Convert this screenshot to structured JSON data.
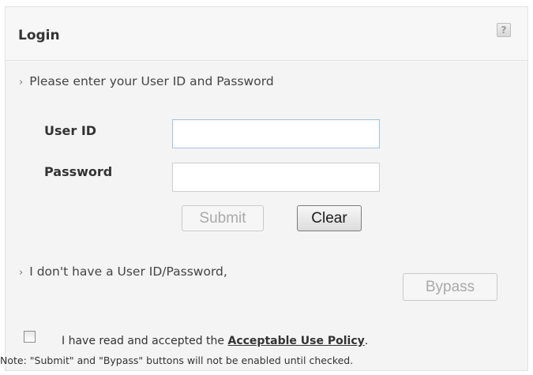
{
  "header": {
    "title": "Login",
    "help_icon": "?"
  },
  "instructions": {
    "enter_credentials": "Please enter your User ID and Password",
    "no_credentials": "I don't have a User ID/Password,"
  },
  "form": {
    "user_id_label": "User ID",
    "password_label": "Password",
    "user_id_value": "",
    "password_value": "",
    "submit_label": "Submit",
    "clear_label": "Clear",
    "bypass_label": "Bypass"
  },
  "policy": {
    "checked": false,
    "text_prefix": "I have read and accepted the ",
    "link_text": "Acceptable Use Policy",
    "text_suffix": ".",
    "note": "Note: \"Submit\" and \"Bypass\" buttons will not be enabled until checked."
  },
  "icons": {
    "chevron": "›"
  }
}
